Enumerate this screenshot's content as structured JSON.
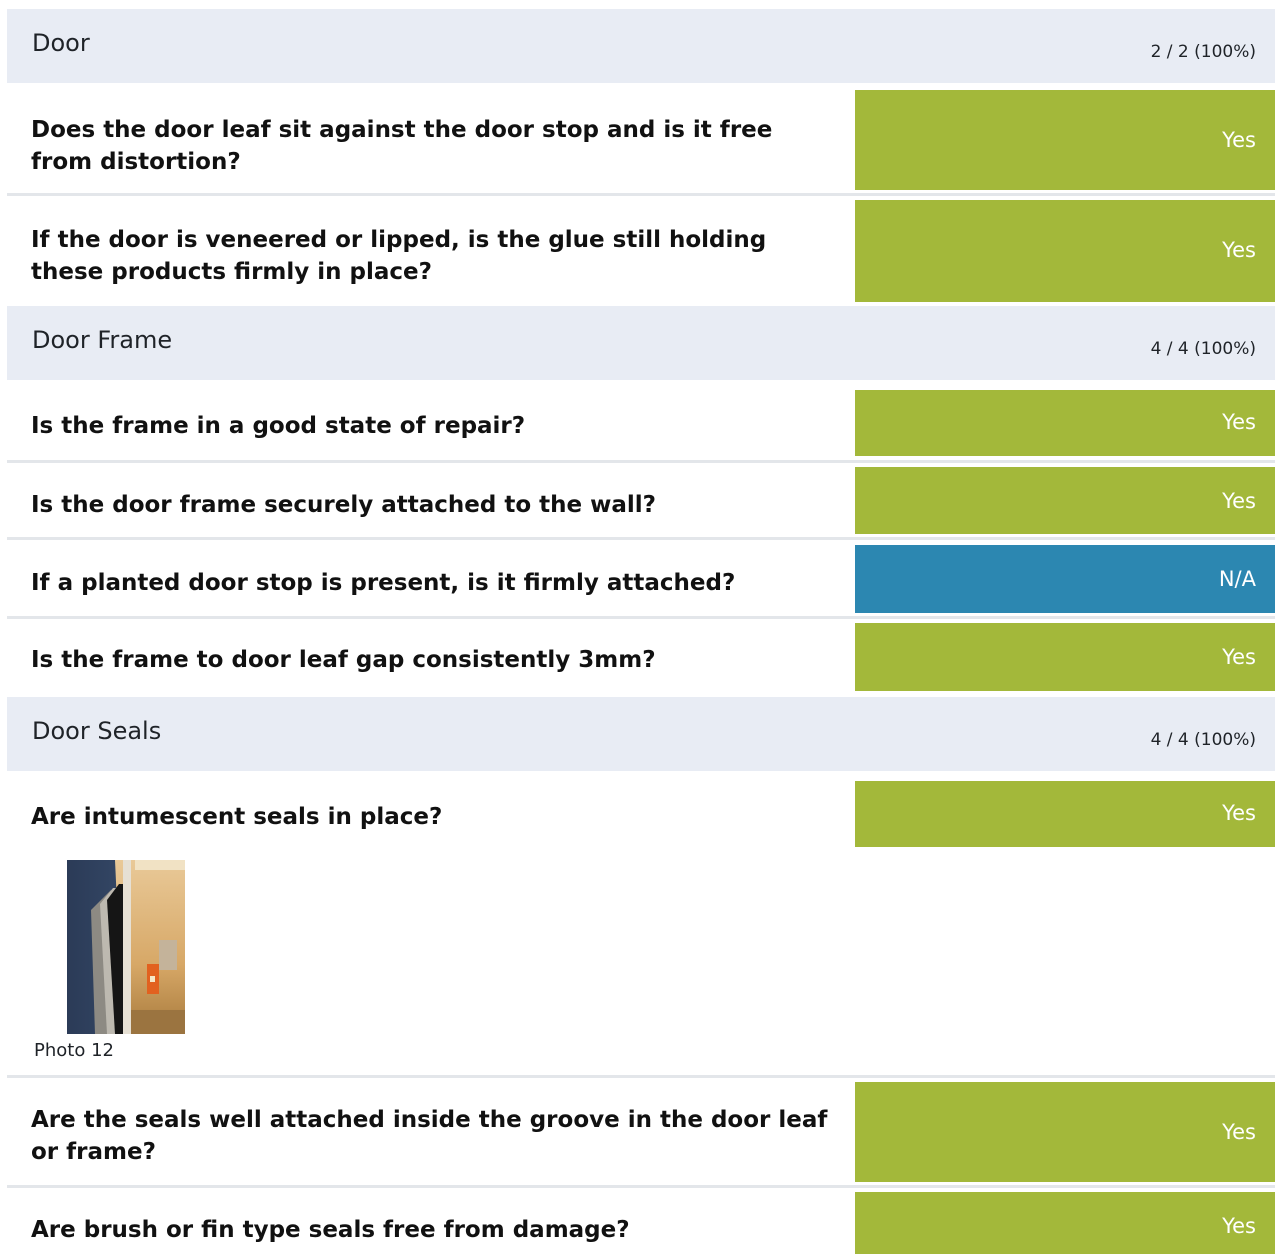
{
  "sections": [
    {
      "title": "Door",
      "score": "2 / 2 (100%)"
    },
    {
      "title": "Door Frame",
      "score": "4 / 4 (100%)"
    },
    {
      "title": "Door Seals",
      "score": "4 / 4 (100%)"
    }
  ],
  "questions": [
    {
      "text": "Does the door leaf sit against the door stop and is it free from distortion?",
      "answer": "Yes"
    },
    {
      "text": "If the door is veneered or lipped, is the glue still holding these products firmly in place?",
      "answer": "Yes"
    },
    {
      "text": "Is the frame in a good state of repair?",
      "answer": "Yes"
    },
    {
      "text": "Is the door frame securely attached to the wall?",
      "answer": "Yes"
    },
    {
      "text": "If a planted door stop is present, is it firmly attached?",
      "answer": "N/A"
    },
    {
      "text": "Is the frame to door leaf gap consistently 3mm?",
      "answer": "Yes"
    },
    {
      "text": "Are intumescent seals in place?",
      "answer": "Yes"
    },
    {
      "text": "Are the seals well attached inside the groove in the door leaf or frame?",
      "answer": "Yes"
    },
    {
      "text": "Are brush or fin type seals free from damage?",
      "answer": "Yes"
    }
  ],
  "photo": {
    "label": "Photo 12"
  },
  "colors": {
    "yes": "#a3b83a",
    "na": "#2c87b1",
    "section_bg": "#e8ecf4"
  }
}
